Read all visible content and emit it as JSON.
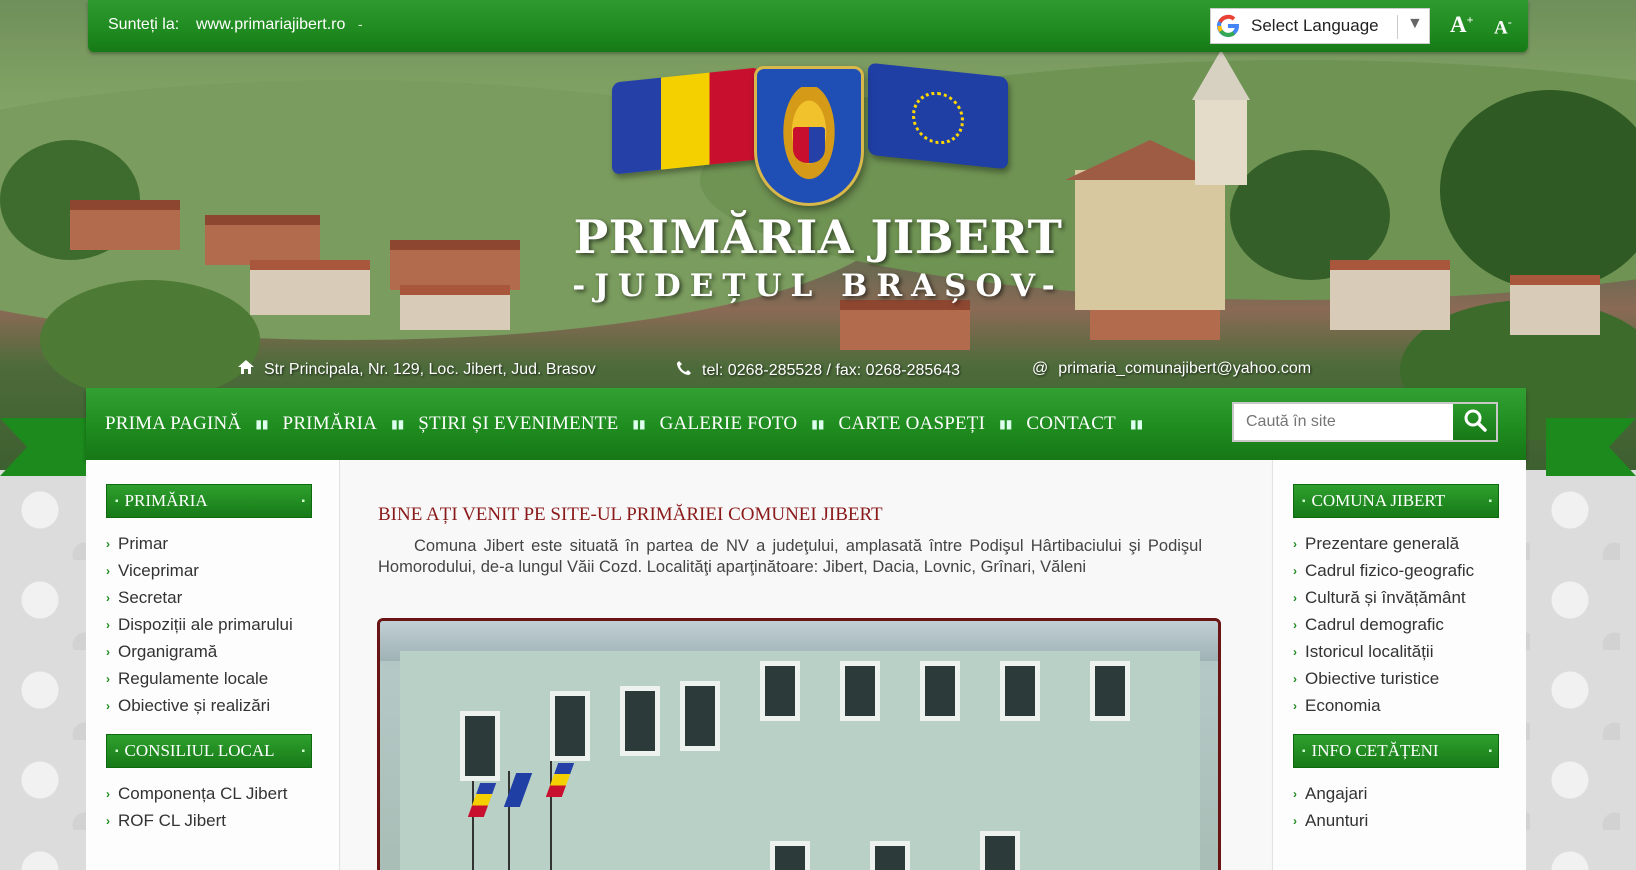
{
  "topbar": {
    "you_are_label": "Sunteți la:",
    "url": "www.primariajibert.ro",
    "url_suffix": "-",
    "language_select": "Select Language",
    "font_increase": "A",
    "font_increase_sup": "+",
    "font_decrease": "A",
    "font_decrease_sup": "-"
  },
  "header": {
    "title": "PRIMĂRIA JIBERT",
    "subtitle": "-JUDEȚUL BRAȘOV-"
  },
  "contact": {
    "address": "Str Principala, Nr. 129, Loc. Jibert, Jud. Brasov",
    "phone": "tel: 0268-285528 / fax: 0268-285643",
    "email": "primaria_comunajibert@yahoo.com",
    "email_icon": "@"
  },
  "nav": {
    "items": [
      "PRIMA PAGINĂ",
      "PRIMĂRIA",
      "ȘTIRI ȘI EVENIMENTE",
      "GALERIE FOTO",
      "CARTE OASPEȚI",
      "CONTACT"
    ],
    "search_placeholder": "Caută în site"
  },
  "left_sidebar": {
    "primaria": {
      "title": "PRIMĂRIA",
      "items": [
        "Primar",
        "Viceprimar",
        "Secretar",
        "Dispoziții ale primarului",
        "Organigramă",
        "Regulamente locale",
        "Obiective și realizări"
      ]
    },
    "consiliul": {
      "title": "CONSILIUL LOCAL",
      "items": [
        "Componența CL Jibert",
        "ROF CL Jibert"
      ]
    }
  },
  "right_sidebar": {
    "comuna": {
      "title": "COMUNA JIBERT",
      "items": [
        "Prezentare generală",
        "Cadrul fizico-geografic",
        "Cultură și învățământ",
        "Cadrul demografic",
        "Istoricul localității",
        "Obiective turistice",
        "Economia"
      ]
    },
    "info": {
      "title": "INFO CETĂȚENI",
      "items": [
        "Angajari",
        "Anunturi"
      ]
    }
  },
  "main": {
    "welcome_title": "BINE AȚI VENIT PE SITE-UL PRIMĂRIEI COMUNEI JIBERT",
    "welcome_text": "Comuna Jibert este situată în partea de NV a judeţului, amplasată între Podişul Hârtibaciului şi Podişul Homorodului, de-a lungul Văii Cozd. Localităţi aparţinătoare: Jibert, Dacia, Lovnic, Grînari, Văleni"
  },
  "colors": {
    "brand_green": "#1f8c1f",
    "title_red": "#8a1a1a",
    "frame_border": "#6a1414"
  },
  "icons": [
    "home-icon",
    "phone-icon",
    "google-icon",
    "search-icon",
    "chevron-right-icon"
  ]
}
